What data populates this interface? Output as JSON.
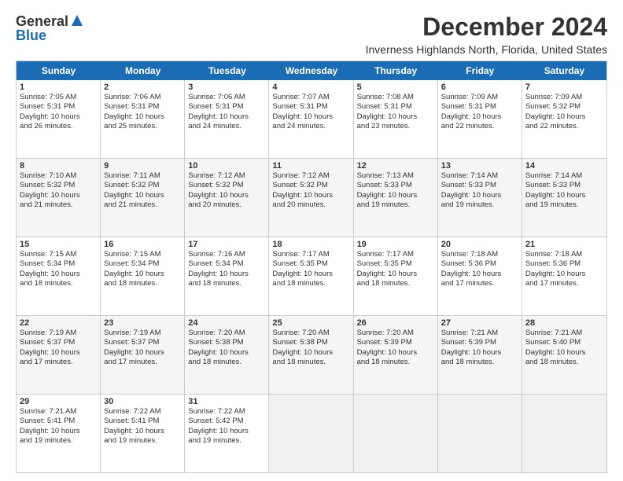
{
  "logo": {
    "general": "General",
    "blue": "Blue"
  },
  "title": "December 2024",
  "subtitle": "Inverness Highlands North, Florida, United States",
  "days": [
    "Sunday",
    "Monday",
    "Tuesday",
    "Wednesday",
    "Thursday",
    "Friday",
    "Saturday"
  ],
  "weeks": [
    [
      {
        "day": "1",
        "info": "Sunrise: 7:05 AM\nSunset: 5:31 PM\nDaylight: 10 hours\nand 26 minutes.",
        "empty": false,
        "shaded": false
      },
      {
        "day": "2",
        "info": "Sunrise: 7:06 AM\nSunset: 5:31 PM\nDaylight: 10 hours\nand 25 minutes.",
        "empty": false,
        "shaded": false
      },
      {
        "day": "3",
        "info": "Sunrise: 7:06 AM\nSunset: 5:31 PM\nDaylight: 10 hours\nand 24 minutes.",
        "empty": false,
        "shaded": false
      },
      {
        "day": "4",
        "info": "Sunrise: 7:07 AM\nSunset: 5:31 PM\nDaylight: 10 hours\nand 24 minutes.",
        "empty": false,
        "shaded": false
      },
      {
        "day": "5",
        "info": "Sunrise: 7:08 AM\nSunset: 5:31 PM\nDaylight: 10 hours\nand 23 minutes.",
        "empty": false,
        "shaded": false
      },
      {
        "day": "6",
        "info": "Sunrise: 7:09 AM\nSunset: 5:31 PM\nDaylight: 10 hours\nand 22 minutes.",
        "empty": false,
        "shaded": false
      },
      {
        "day": "7",
        "info": "Sunrise: 7:09 AM\nSunset: 5:32 PM\nDaylight: 10 hours\nand 22 minutes.",
        "empty": false,
        "shaded": false
      }
    ],
    [
      {
        "day": "8",
        "info": "Sunrise: 7:10 AM\nSunset: 5:32 PM\nDaylight: 10 hours\nand 21 minutes.",
        "empty": false,
        "shaded": true
      },
      {
        "day": "9",
        "info": "Sunrise: 7:11 AM\nSunset: 5:32 PM\nDaylight: 10 hours\nand 21 minutes.",
        "empty": false,
        "shaded": true
      },
      {
        "day": "10",
        "info": "Sunrise: 7:12 AM\nSunset: 5:32 PM\nDaylight: 10 hours\nand 20 minutes.",
        "empty": false,
        "shaded": true
      },
      {
        "day": "11",
        "info": "Sunrise: 7:12 AM\nSunset: 5:32 PM\nDaylight: 10 hours\nand 20 minutes.",
        "empty": false,
        "shaded": true
      },
      {
        "day": "12",
        "info": "Sunrise: 7:13 AM\nSunset: 5:33 PM\nDaylight: 10 hours\nand 19 minutes.",
        "empty": false,
        "shaded": true
      },
      {
        "day": "13",
        "info": "Sunrise: 7:14 AM\nSunset: 5:33 PM\nDaylight: 10 hours\nand 19 minutes.",
        "empty": false,
        "shaded": true
      },
      {
        "day": "14",
        "info": "Sunrise: 7:14 AM\nSunset: 5:33 PM\nDaylight: 10 hours\nand 19 minutes.",
        "empty": false,
        "shaded": true
      }
    ],
    [
      {
        "day": "15",
        "info": "Sunrise: 7:15 AM\nSunset: 5:34 PM\nDaylight: 10 hours\nand 18 minutes.",
        "empty": false,
        "shaded": false
      },
      {
        "day": "16",
        "info": "Sunrise: 7:15 AM\nSunset: 5:34 PM\nDaylight: 10 hours\nand 18 minutes.",
        "empty": false,
        "shaded": false
      },
      {
        "day": "17",
        "info": "Sunrise: 7:16 AM\nSunset: 5:34 PM\nDaylight: 10 hours\nand 18 minutes.",
        "empty": false,
        "shaded": false
      },
      {
        "day": "18",
        "info": "Sunrise: 7:17 AM\nSunset: 5:35 PM\nDaylight: 10 hours\nand 18 minutes.",
        "empty": false,
        "shaded": false
      },
      {
        "day": "19",
        "info": "Sunrise: 7:17 AM\nSunset: 5:35 PM\nDaylight: 10 hours\nand 18 minutes.",
        "empty": false,
        "shaded": false
      },
      {
        "day": "20",
        "info": "Sunrise: 7:18 AM\nSunset: 5:36 PM\nDaylight: 10 hours\nand 17 minutes.",
        "empty": false,
        "shaded": false
      },
      {
        "day": "21",
        "info": "Sunrise: 7:18 AM\nSunset: 5:36 PM\nDaylight: 10 hours\nand 17 minutes.",
        "empty": false,
        "shaded": false
      }
    ],
    [
      {
        "day": "22",
        "info": "Sunrise: 7:19 AM\nSunset: 5:37 PM\nDaylight: 10 hours\nand 17 minutes.",
        "empty": false,
        "shaded": true
      },
      {
        "day": "23",
        "info": "Sunrise: 7:19 AM\nSunset: 5:37 PM\nDaylight: 10 hours\nand 17 minutes.",
        "empty": false,
        "shaded": true
      },
      {
        "day": "24",
        "info": "Sunrise: 7:20 AM\nSunset: 5:38 PM\nDaylight: 10 hours\nand 18 minutes.",
        "empty": false,
        "shaded": true
      },
      {
        "day": "25",
        "info": "Sunrise: 7:20 AM\nSunset: 5:38 PM\nDaylight: 10 hours\nand 18 minutes.",
        "empty": false,
        "shaded": true
      },
      {
        "day": "26",
        "info": "Sunrise: 7:20 AM\nSunset: 5:39 PM\nDaylight: 10 hours\nand 18 minutes.",
        "empty": false,
        "shaded": true
      },
      {
        "day": "27",
        "info": "Sunrise: 7:21 AM\nSunset: 5:39 PM\nDaylight: 10 hours\nand 18 minutes.",
        "empty": false,
        "shaded": true
      },
      {
        "day": "28",
        "info": "Sunrise: 7:21 AM\nSunset: 5:40 PM\nDaylight: 10 hours\nand 18 minutes.",
        "empty": false,
        "shaded": true
      }
    ],
    [
      {
        "day": "29",
        "info": "Sunrise: 7:21 AM\nSunset: 5:41 PM\nDaylight: 10 hours\nand 19 minutes.",
        "empty": false,
        "shaded": false
      },
      {
        "day": "30",
        "info": "Sunrise: 7:22 AM\nSunset: 5:41 PM\nDaylight: 10 hours\nand 19 minutes.",
        "empty": false,
        "shaded": false
      },
      {
        "day": "31",
        "info": "Sunrise: 7:22 AM\nSunset: 5:42 PM\nDaylight: 10 hours\nand 19 minutes.",
        "empty": false,
        "shaded": false
      },
      {
        "day": "",
        "info": "",
        "empty": true,
        "shaded": false
      },
      {
        "day": "",
        "info": "",
        "empty": true,
        "shaded": false
      },
      {
        "day": "",
        "info": "",
        "empty": true,
        "shaded": false
      },
      {
        "day": "",
        "info": "",
        "empty": true,
        "shaded": false
      }
    ]
  ]
}
